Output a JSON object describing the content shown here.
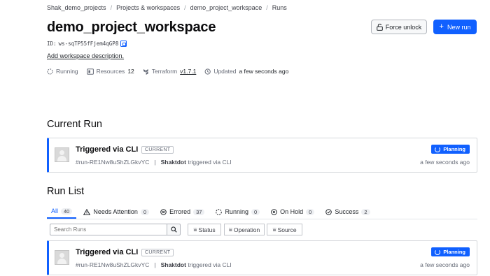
{
  "breadcrumb": [
    "Shak_demo_projects",
    "Projects & workspaces",
    "demo_project_workspace",
    "Runs"
  ],
  "workspace": {
    "name": "demo_project_workspace",
    "id_label": "ID:",
    "id_value": "ws-sqTP55fFjem4qGP8",
    "add_description": "Add workspace description."
  },
  "actions": {
    "force_unlock": "Force unlock",
    "new_run": "New run"
  },
  "meta": {
    "status": "Running",
    "resources_label": "Resources",
    "resources_count": "12",
    "terraform_label": "Terraform",
    "terraform_version": "v1.7.1",
    "updated_label": "Updated",
    "updated_value": "a few seconds ago"
  },
  "current_run": {
    "heading": "Current Run",
    "title": "Triggered via CLI",
    "tag": "CURRENT",
    "run_id": "#run-RE1Nw8uShZLGkvYC",
    "user": "Shaktdot",
    "trigger_text": "triggered via CLI",
    "status": "Planning",
    "time": "a few seconds ago"
  },
  "run_list": {
    "heading": "Run List",
    "tabs": [
      {
        "label": "All",
        "count": "40"
      },
      {
        "label": "Needs Attention",
        "count": "0"
      },
      {
        "label": "Errored",
        "count": "37"
      },
      {
        "label": "Running",
        "count": "0"
      },
      {
        "label": "On Hold",
        "count": "0"
      },
      {
        "label": "Success",
        "count": "2"
      }
    ],
    "search_placeholder": "Search Runs",
    "filters": {
      "status": "Status",
      "operation": "Operation",
      "source": "Source"
    },
    "runs": [
      {
        "title": "Triggered via CLI",
        "tag": "CURRENT",
        "run_id": "#run-RE1Nw8uShZLGkvYC",
        "user": "Shaktdot",
        "trigger_text": "triggered via CLI",
        "status": "Planning",
        "time": "a few seconds ago"
      }
    ]
  },
  "colors": {
    "primary": "#1060ff",
    "border": "#d6d8dc",
    "muted_text": "#656a76"
  }
}
